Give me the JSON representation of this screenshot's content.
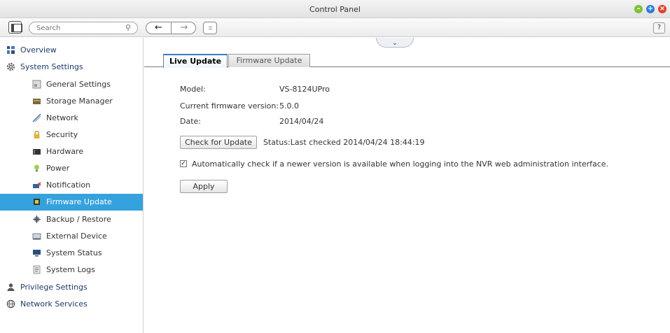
{
  "window": {
    "title": "Control Panel",
    "controls": [
      "minimize",
      "maximize",
      "close"
    ]
  },
  "toolbar": {
    "search_placeholder": "Search",
    "back_symbol": "←",
    "forward_symbol": "→",
    "apps_symbol": ":::",
    "help_label": "?"
  },
  "sidebar": {
    "overview": "Overview",
    "system_settings": "System Settings",
    "items": [
      {
        "label": "General Settings",
        "icon": "general-settings-icon"
      },
      {
        "label": "Storage Manager",
        "icon": "storage-manager-icon"
      },
      {
        "label": "Network",
        "icon": "network-icon"
      },
      {
        "label": "Security",
        "icon": "lock-icon"
      },
      {
        "label": "Hardware",
        "icon": "hardware-icon"
      },
      {
        "label": "Power",
        "icon": "power-bulb-icon"
      },
      {
        "label": "Notification",
        "icon": "notification-icon"
      },
      {
        "label": "Firmware Update",
        "icon": "firmware-chip-icon",
        "active": true
      },
      {
        "label": "Backup / Restore",
        "icon": "backup-icon"
      },
      {
        "label": "External Device",
        "icon": "external-device-icon"
      },
      {
        "label": "System Status",
        "icon": "monitor-icon"
      },
      {
        "label": "System Logs",
        "icon": "logs-icon"
      }
    ],
    "privilege_settings": "Privilege Settings",
    "network_services": "Network Services"
  },
  "tabs": {
    "live_update": "Live Update",
    "firmware_update": "Firmware Update"
  },
  "info": {
    "model_label": "Model:",
    "model_value": "VS-8124UPro",
    "firmware_label": "Current firmware version:",
    "firmware_value": "5.0.0",
    "date_label": "Date:",
    "date_value": "2014/04/24"
  },
  "actions": {
    "check_update": "Check for Update",
    "status": "Status:Last checked 2014/04/24 18:44:19",
    "auto_check_label": "Automatically check if a newer version is available when logging into the NVR web administration interface.",
    "auto_check_checked": true,
    "apply": "Apply"
  },
  "colors": {
    "active_item": "#35a2dd",
    "nav_text": "#1c3b67",
    "minimize": "#7fc23a",
    "maximize": "#2f7fd7",
    "close": "#e1402e"
  }
}
